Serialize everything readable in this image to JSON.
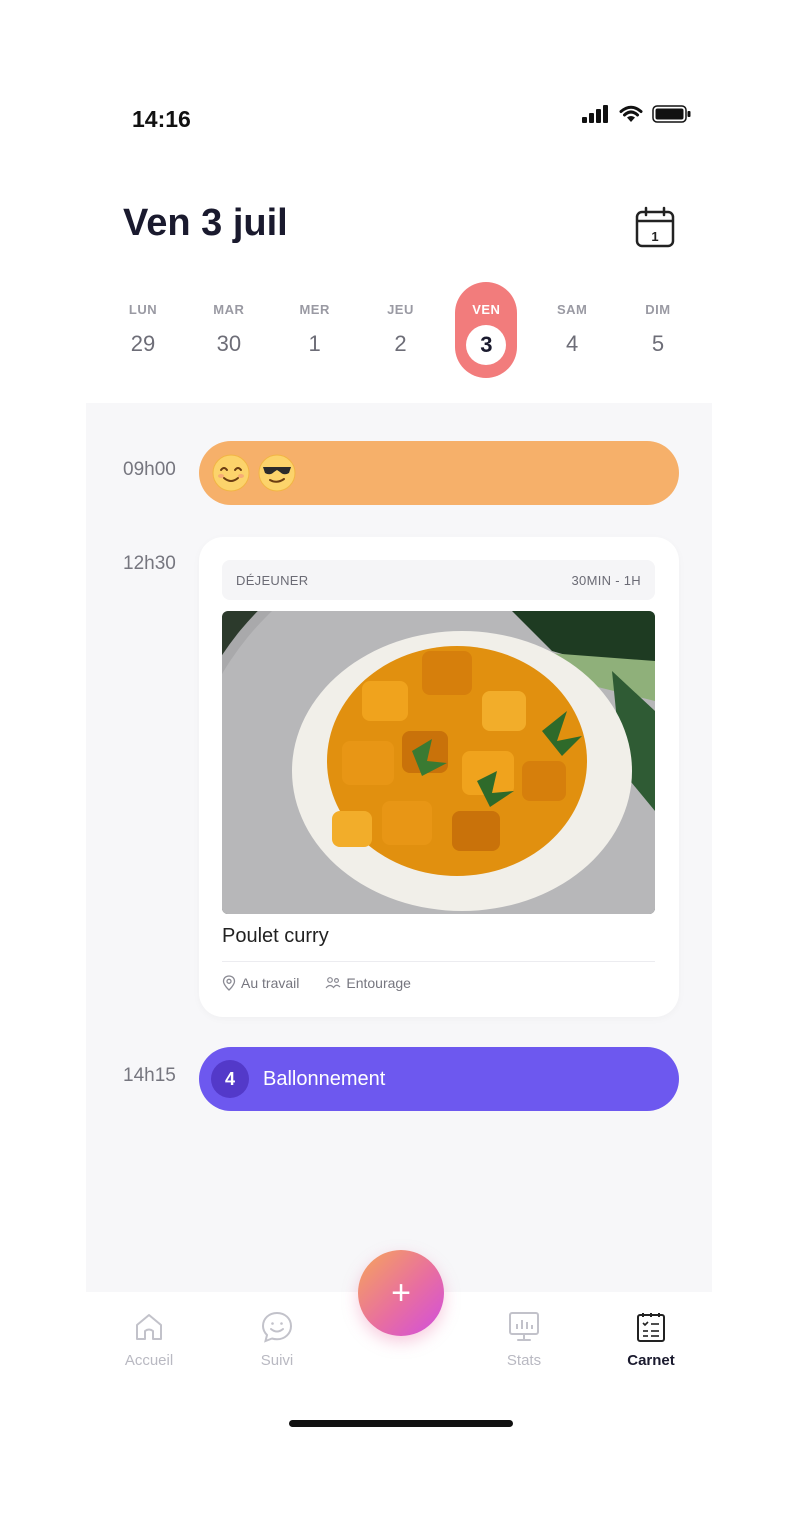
{
  "status": {
    "time": "14:16"
  },
  "header": {
    "title": "Ven 3 juil",
    "calendar_day": "1"
  },
  "week": [
    {
      "name": "LUN",
      "num": "29",
      "selected": false
    },
    {
      "name": "MAR",
      "num": "30",
      "selected": false
    },
    {
      "name": "MER",
      "num": "1",
      "selected": false
    },
    {
      "name": "JEU",
      "num": "2",
      "selected": false
    },
    {
      "name": "VEN",
      "num": "3",
      "selected": true
    },
    {
      "name": "SAM",
      "num": "4",
      "selected": false
    },
    {
      "name": "DIM",
      "num": "5",
      "selected": false
    }
  ],
  "timeline": {
    "mood": {
      "time": "09h00",
      "emojis": [
        "smiling-face-icon",
        "sunglasses-face-icon"
      ],
      "color": "#f6b06a"
    },
    "meal": {
      "time": "12h30",
      "type": "DÉJEUNER",
      "duration": "30MIN - 1H",
      "name": "Poulet curry",
      "location": "Au travail",
      "company": "Entourage"
    },
    "symptom": {
      "time": "14h15",
      "intensity": "4",
      "label": "Ballonnement",
      "color": "#6d58ef"
    }
  },
  "nav": {
    "home": "Accueil",
    "tracking": "Suivi",
    "add": "+",
    "stats": "Stats",
    "journal": "Carnet",
    "active": "Carnet"
  },
  "colors": {
    "accent_day": "#f27c7c",
    "mood": "#f6b06a",
    "symptom": "#6d58ef"
  }
}
